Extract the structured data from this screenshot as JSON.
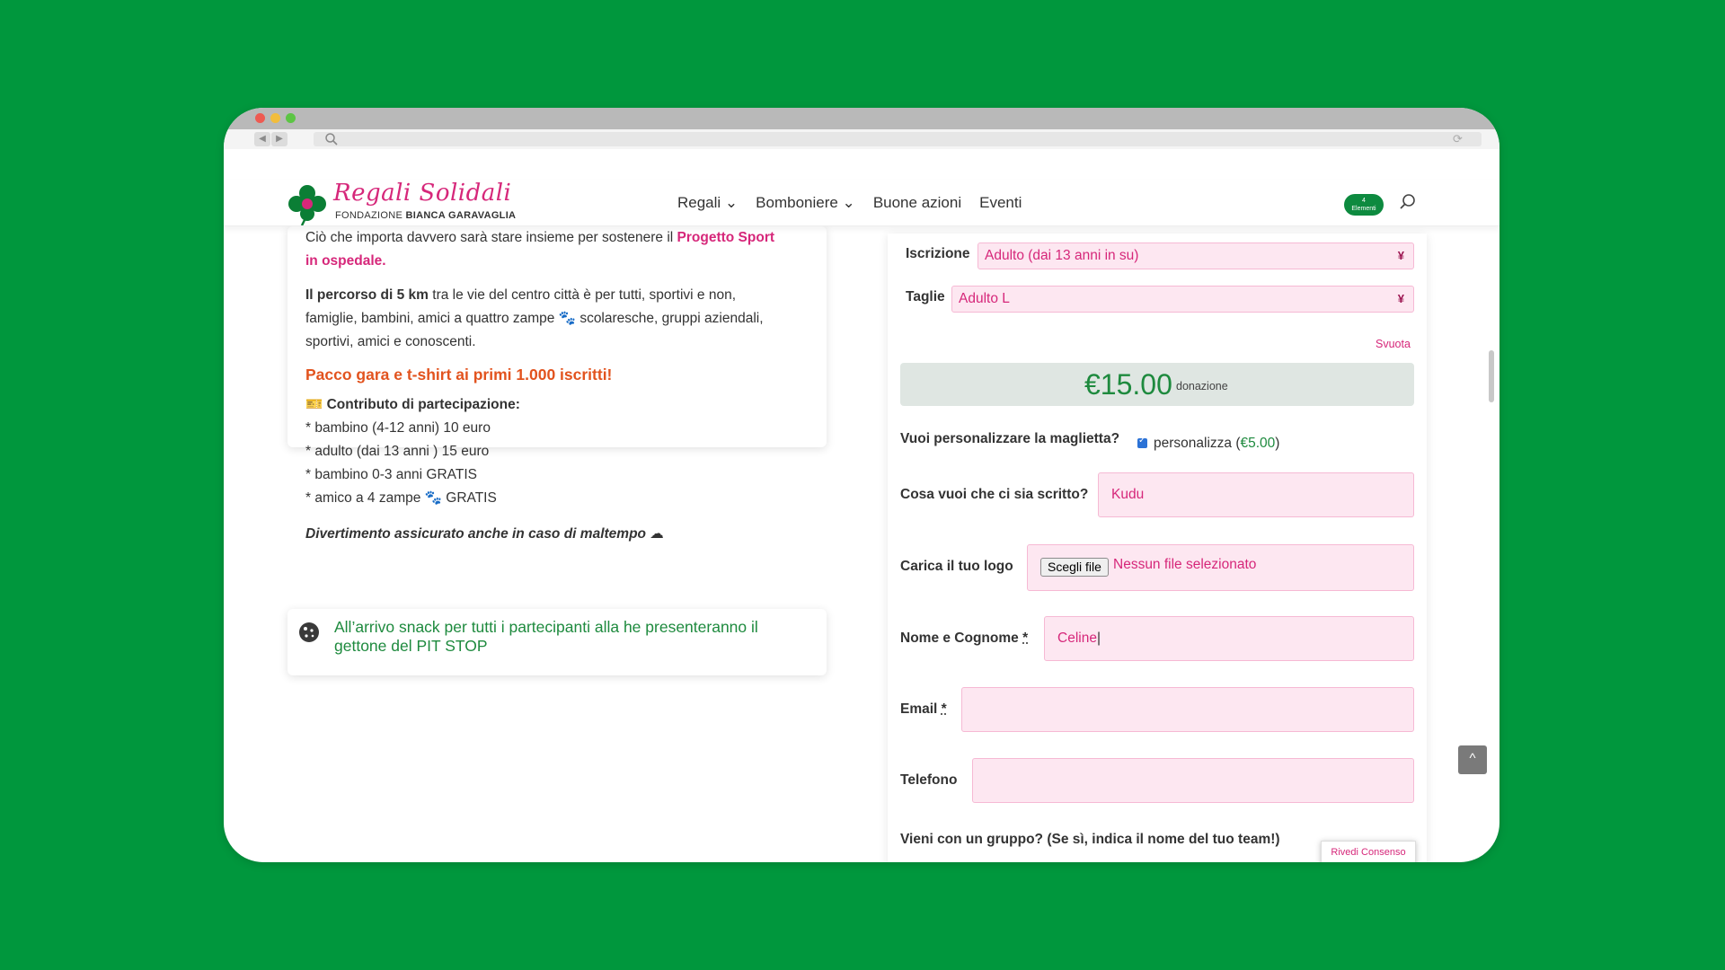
{
  "header": {
    "logo_script": "Regali Solidali",
    "logo_sub_plain": "FONDAZIONE ",
    "logo_sub_bold": "BIANCA GARAVAGLIA",
    "menu": [
      "Regali ⌄",
      "Bomboniere ⌄",
      "Buone azioni",
      "Eventi"
    ],
    "cart_count": "4",
    "cart_label": "Elementi"
  },
  "intro": {
    "line1_plain": "Ciò che importa davvero sarà stare insieme per sostenere il ",
    "line1_link": "Progetto Sport",
    "line2_link": "in ospedale.",
    "p2_bold": "Il percorso di 5 km",
    "p2_rest1": " tra le vie del centro città è per tutti, sportivi e non,",
    "p2_line2": "famiglie, bambini, amici a quattro zampe 🐾 scolaresche, gruppi aziendali,",
    "p2_line3": "sportivi, amici e conoscenti.",
    "highlight": "Pacco gara e t-shirt ai primi 1.000 iscritti!",
    "contrib_title": "🎫 Contributo di partecipazione:",
    "contrib_items": [
      "* bambino (4-12 anni) 10 euro",
      "* adulto (dai 13 anni ) 15 euro",
      "* bambino 0-3 anni GRATIS",
      "* amico a 4 zampe 🐾 GRATIS"
    ],
    "weather_note": "Divertimento assicurato anche in caso di maltempo ☁"
  },
  "snack": {
    "text": "All’arrivo snack per tutti i partecipanti alla he presenteranno il gettone del PIT STOP"
  },
  "form": {
    "iscrizione_label": "Iscrizione",
    "iscrizione_value": "Adulto (dai 13 anni in su)",
    "taglie_label": "Taglie",
    "taglie_value": "Adulto L",
    "svuota": "Svuota",
    "price": "€15.00",
    "price_sub": "donazione",
    "personalize_label": "Vuoi personalizzare la maglietta?",
    "personalize_check_plain": "personalizza (",
    "personalize_check_price": "€5.00",
    "personalize_check_end": ")",
    "write_label": "Cosa vuoi che ci sia scritto?",
    "write_value": "Kudu",
    "logo_label": "Carica il tuo logo",
    "file_button": "Scegli file",
    "file_status": "Nessun file selezionato",
    "name_label": "Nome e Cognome",
    "name_value": "Celine",
    "email_label": "Email",
    "email_value": "",
    "phone_label": "Telefono",
    "phone_value": "",
    "group_label": "Vieni con un gruppo? (Se sì, indica il nome del tuo team!)",
    "required_mark": "*"
  },
  "consent_button": "Rivedi Consenso",
  "colors": {
    "page_bg": "#00973d",
    "accent_pink": "#d6277a",
    "accent_green": "#1e8a3e",
    "input_bg": "#fde7f1",
    "highlight_orange": "#e2531e"
  }
}
